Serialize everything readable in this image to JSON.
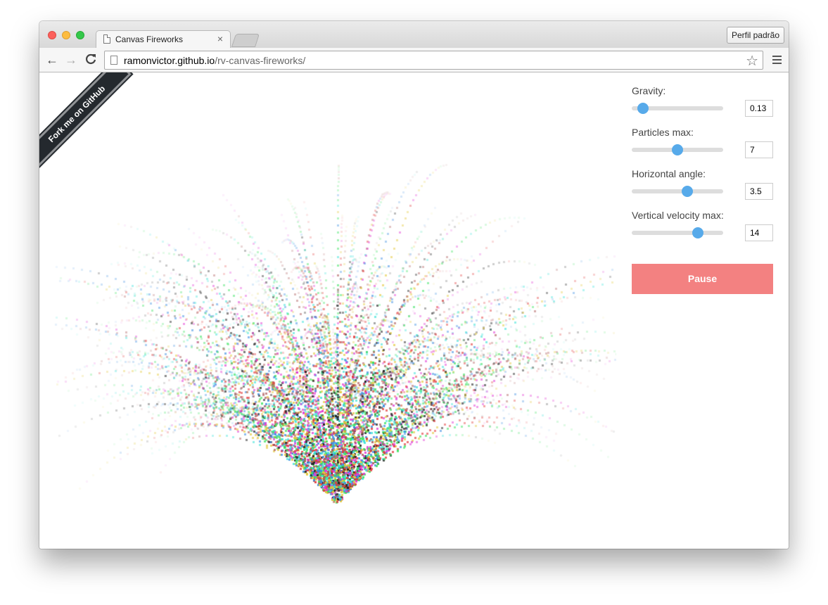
{
  "browser": {
    "tab_title": "Canvas Fireworks",
    "tab_close": "×",
    "profile_button": "Perfil padrão",
    "url_host": "ramonvictor.github.io",
    "url_path": "/rv-canvas-fireworks/",
    "back_icon": "←",
    "forward_icon": "→",
    "reload_icon": "C",
    "star_icon": "☆"
  },
  "ribbon": {
    "text": "Fork me on GitHub"
  },
  "controls": [
    {
      "label": "Gravity:",
      "value": "0.13",
      "slider_fraction": 0.12
    },
    {
      "label": "Particles max:",
      "value": "7",
      "slider_fraction": 0.5
    },
    {
      "label": "Horizontal angle:",
      "value": "3.5",
      "slider_fraction": 0.61
    },
    {
      "label": "Vertical velocity max:",
      "value": "14",
      "slider_fraction": 0.72
    }
  ],
  "pause_button": {
    "label": "Pause",
    "color": "#f38181"
  },
  "accent_color": "#57aaea"
}
